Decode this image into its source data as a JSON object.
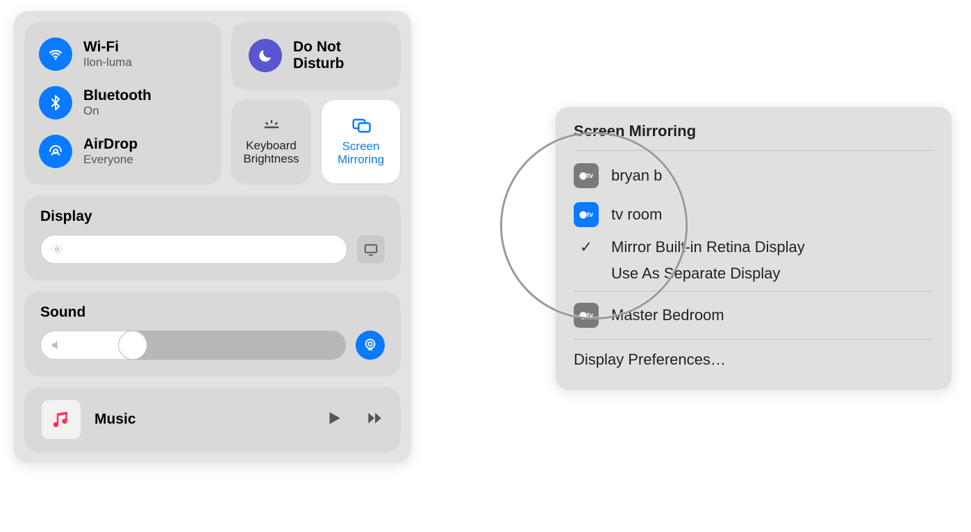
{
  "control_center": {
    "connectivity": {
      "wifi": {
        "title": "Wi-Fi",
        "sub": "Ilon-luma"
      },
      "bluetooth": {
        "title": "Bluetooth",
        "sub": "On"
      },
      "airdrop": {
        "title": "AirDrop",
        "sub": "Everyone"
      }
    },
    "dnd": {
      "line1": "Do Not",
      "line2": "Disturb"
    },
    "keyboard_brightness": {
      "line1": "Keyboard",
      "line2": "Brightness"
    },
    "screen_mirroring": {
      "line1": "Screen",
      "line2": "Mirroring"
    },
    "display_tile_title": "Display",
    "sound_tile_title": "Sound",
    "music_title": "Music"
  },
  "screen_mirroring_popup": {
    "header": "Screen Mirroring",
    "devices": [
      {
        "label": "bryan b",
        "selected": false
      },
      {
        "label": "tv room",
        "selected": true
      }
    ],
    "options": [
      {
        "label": "Mirror Built-in Retina Display",
        "checked": true
      },
      {
        "label": "Use As Separate Display",
        "checked": false
      }
    ],
    "more_devices": [
      {
        "label": "Master Bedroom"
      }
    ],
    "footer": "Display Preferences…"
  },
  "colors": {
    "accent": "#0a7aff",
    "dnd": "#5856d0"
  }
}
